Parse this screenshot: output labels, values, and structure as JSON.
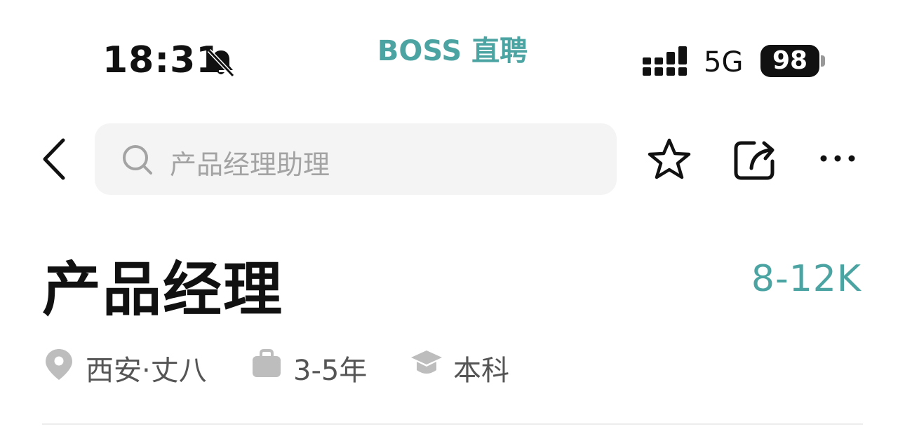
{
  "status_bar": {
    "time": "18:31",
    "app_name": "BOSS 直聘",
    "network": "5G",
    "battery": "98",
    "icons": [
      "bell-muted-icon",
      "signal-icon"
    ]
  },
  "nav": {
    "search_placeholder": "产品经理助理",
    "icons": [
      "back-chevron-icon",
      "search-icon",
      "star-icon",
      "share-icon",
      "more-icon"
    ]
  },
  "job": {
    "title": "产品经理",
    "salary": "8-12K",
    "location": "西安·丈八",
    "experience": "3-5年",
    "education": "本科",
    "meta_icons": [
      "location-pin-icon",
      "briefcase-icon",
      "graduation-cap-icon"
    ]
  },
  "colors": {
    "accent": "#4ba4a2",
    "text_primary": "#111111",
    "text_secondary": "#555555",
    "placeholder": "#a3a3a3",
    "search_bg": "#f4f4f4",
    "meta_icon": "#bdbdbd"
  }
}
